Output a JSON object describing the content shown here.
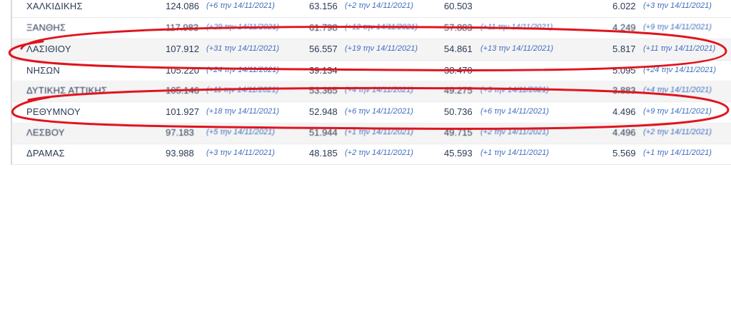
{
  "rows": [
    {
      "name": "ΧΑΛΚΙΔΙΚΗΣ",
      "v1": "124.086",
      "c1": "(+6 την 14/11/2021)",
      "v2": "63.156",
      "c2": "(+2 την 14/11/2021)",
      "v3": "60.503",
      "c3": "",
      "v4": "6.022",
      "c4": "(+3 την 14/11/2021)"
    },
    {
      "name": "ΞΑΝΘΗΣ",
      "v1": "117.983",
      "c1": "(+29 την 14/11/2021)",
      "v2": "61.798",
      "c2": "(+12 την 14/11/2021)",
      "v3": "57.883",
      "c3": "(+11 την 14/11/2021)",
      "v4": "4.249",
      "c4": "(+9 την 14/11/2021)"
    },
    {
      "name": "ΛΑΣΙΘΙΟΥ",
      "v1": "107.912",
      "c1": "(+31 την 14/11/2021)",
      "v2": "56.557",
      "c2": "(+19 την 14/11/2021)",
      "v3": "54.861",
      "c3": "(+13 την 14/11/2021)",
      "v4": "5.817",
      "c4": "(+11 την 14/11/2021)"
    },
    {
      "name": "ΝΗΣΩΝ",
      "v1": "105.220",
      "c1": "(+24 την 14/11/2021)",
      "v2": "39.134",
      "c2": "",
      "v3": "38.470",
      "c3": "",
      "v4": "5.095",
      "c4": "(+24 την 14/11/2021)"
    },
    {
      "name": "ΔΥΤΙΚΗΣ ΑΤΤΙΚΗΣ",
      "v1": "105.146",
      "c1": "(+11 την 14/11/2021)",
      "v2": "53.365",
      "c2": "(+4 την 14/11/2021)",
      "v3": "49.275",
      "c3": "(+3 την 14/11/2021)",
      "v4": "3.883",
      "c4": "(+4 την 14/11/2021)"
    },
    {
      "name": "ΡΕΘΥΜΝΟΥ",
      "v1": "101.927",
      "c1": "(+18 την 14/11/2021)",
      "v2": "52.948",
      "c2": "(+6 την 14/11/2021)",
      "v3": "50.736",
      "c3": "(+6 την 14/11/2021)",
      "v4": "4.496",
      "c4": "(+9 την 14/11/2021)"
    },
    {
      "name": "ΛΕΣΒΟΥ",
      "v1": "97.183",
      "c1": "(+5 την 14/11/2021)",
      "v2": "51.944",
      "c2": "(+1 την 14/11/2021)",
      "v3": "49.715",
      "c3": "(+2 την 14/11/2021)",
      "v4": "4.496",
      "c4": "(+2 την 14/11/2021)"
    },
    {
      "name": "ΔΡΑΜΑΣ",
      "v1": "93.988",
      "c1": "(+3 την 14/11/2021)",
      "v2": "48.185",
      "c2": "(+2 την 14/11/2021)",
      "v3": "45.593",
      "c3": "(+1 την 14/11/2021)",
      "v4": "5.569",
      "c4": "(+1 την 14/11/2021)"
    }
  ],
  "colors": {
    "annotation": "#e0141e",
    "text": "#2b3b55",
    "change_text": "#3e6dbf",
    "alt_row": "#f4f4f4"
  }
}
